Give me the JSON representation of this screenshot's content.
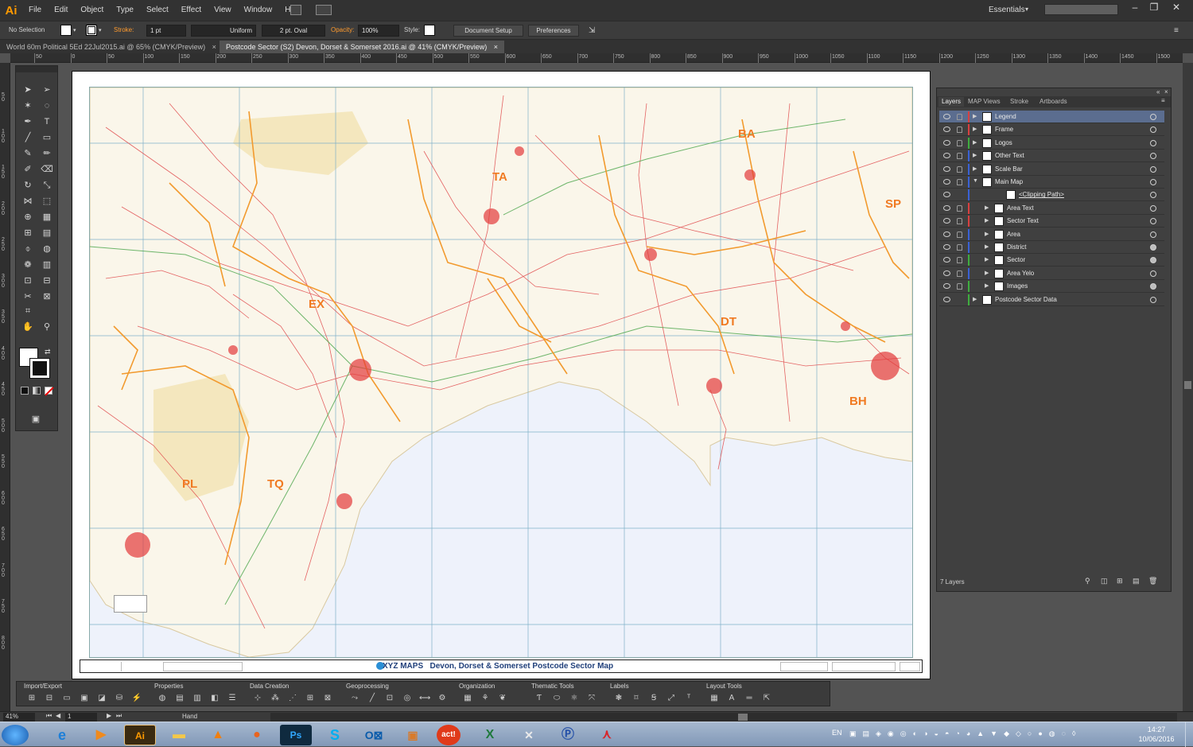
{
  "menubar": {
    "logo": "Ai",
    "items": [
      "File",
      "Edit",
      "Object",
      "Type",
      "Select",
      "Effect",
      "View",
      "Window",
      "Help"
    ],
    "workspace": "Essentials"
  },
  "control_bar": {
    "selection": "No Selection",
    "stroke_label": "Stroke:",
    "stroke_weight": "1 pt",
    "profile": "Uniform",
    "brush": "2 pt. Oval",
    "opacity_label": "Opacity:",
    "opacity": "100%",
    "style_label": "Style:",
    "document_setup": "Document Setup",
    "preferences": "Preferences"
  },
  "tabs": [
    {
      "label": "World 60m Political 5Ed 22Jul2015.ai @ 65% (CMYK/Preview)",
      "active": false
    },
    {
      "label": "Postcode Sector (S2) Devon, Dorset & Somerset 2016.ai @ 41% (CMYK/Preview)",
      "active": true
    }
  ],
  "ruler_top": [
    "50",
    "0",
    "50",
    "100",
    "150",
    "200",
    "250",
    "300",
    "350",
    "400",
    "450",
    "500",
    "550",
    "600",
    "650",
    "700",
    "750",
    "800",
    "850",
    "900",
    "950",
    "1000",
    "1050",
    "1100",
    "1150",
    "1200",
    "1250",
    "1300",
    "1350",
    "1400",
    "1450",
    "1500"
  ],
  "ruler_left": [
    "5 0",
    "1 0 0",
    "1 5 0",
    "2 0 0",
    "2 5 0",
    "3 0 0",
    "3 5 0",
    "4 0 0",
    "4 5 0",
    "5 0 0",
    "5 5 0",
    "6 0 0",
    "6 5 0",
    "7 0 0",
    "7 5 0",
    "8 0 0"
  ],
  "map": {
    "title_brand": "XYZ MAPS",
    "title": "Devon, Dorset & Somerset Postcode Sector Map",
    "area_labels": [
      "TA",
      "BA",
      "SP",
      "EX",
      "DT",
      "BH",
      "PL",
      "TQ"
    ]
  },
  "layers_panel": {
    "tabs": [
      "Layers",
      "MAP Views",
      "Stroke",
      "Artboards"
    ],
    "rows": [
      {
        "name": "Legend",
        "color": "#d84040",
        "indent": 0,
        "expanded": false,
        "selected": true,
        "target_filled": false
      },
      {
        "name": "Frame",
        "color": "#d84040",
        "indent": 0,
        "expanded": false,
        "selected": false,
        "target_filled": false
      },
      {
        "name": "Logos",
        "color": "#3fae3f",
        "indent": 0,
        "expanded": false,
        "selected": false,
        "target_filled": false
      },
      {
        "name": "Other Text",
        "color": "#3a62d6",
        "indent": 0,
        "expanded": false,
        "selected": false,
        "target_filled": false
      },
      {
        "name": "Scale Bar",
        "color": "#3a62d6",
        "indent": 0,
        "expanded": false,
        "selected": false,
        "target_filled": false
      },
      {
        "name": "Main Map",
        "color": "#3a62d6",
        "indent": 0,
        "expanded": true,
        "selected": false,
        "target_filled": false
      },
      {
        "name": "<Clipping Path>",
        "color": "#3a62d6",
        "indent": 2,
        "expanded": false,
        "selected": false,
        "target_filled": false
      },
      {
        "name": "Area Text",
        "color": "#d84040",
        "indent": 1,
        "expanded": false,
        "selected": false,
        "target_filled": false
      },
      {
        "name": "Sector Text",
        "color": "#d84040",
        "indent": 1,
        "expanded": false,
        "selected": false,
        "target_filled": false
      },
      {
        "name": "Area",
        "color": "#3a62d6",
        "indent": 1,
        "expanded": false,
        "selected": false,
        "target_filled": false
      },
      {
        "name": "District",
        "color": "#3a62d6",
        "indent": 1,
        "expanded": false,
        "selected": false,
        "target_filled": true
      },
      {
        "name": "Sector",
        "color": "#3fae3f",
        "indent": 1,
        "expanded": false,
        "selected": false,
        "target_filled": true
      },
      {
        "name": "Area Yelo",
        "color": "#3a62d6",
        "indent": 1,
        "expanded": false,
        "selected": false,
        "target_filled": false
      },
      {
        "name": "Images",
        "color": "#3fae3f",
        "indent": 1,
        "expanded": false,
        "selected": false,
        "target_filled": true
      },
      {
        "name": "Postcode Sector Data",
        "color": "#3fae3f",
        "indent": 0,
        "expanded": false,
        "selected": false,
        "target_filled": false
      }
    ],
    "count": "7 Layers"
  },
  "bottom_toolbar": {
    "groups": [
      "Import/Export",
      "Properties",
      "Data Creation",
      "Geoprocessing",
      "Organization",
      "Thematic Tools",
      "Labels",
      "Layout Tools"
    ]
  },
  "statusbar": {
    "zoom": "41%",
    "page": "1",
    "tool": "Hand"
  },
  "taskbar": {
    "lang": "EN",
    "time": "14:27",
    "date": "10/06/2016"
  }
}
